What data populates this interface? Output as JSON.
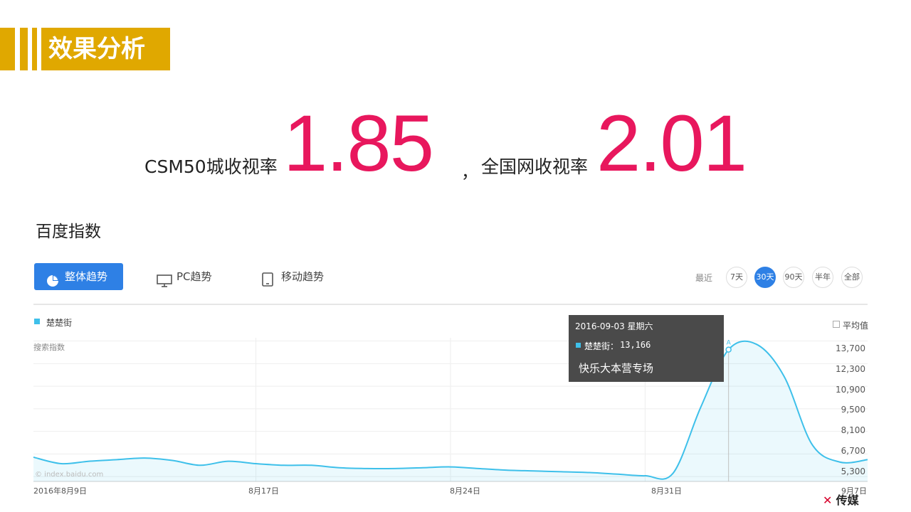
{
  "header": {
    "title": "效果分析"
  },
  "kpis": [
    {
      "label": "CSM50城收视率",
      "value": "1.85"
    },
    {
      "label": "全国网收视率",
      "value": "2.01"
    }
  ],
  "separator": "，",
  "section_title": "百度指数",
  "tabs": [
    {
      "label": "整体趋势",
      "icon": "pie-chart-icon",
      "active": true
    },
    {
      "label": "PC趋势",
      "icon": "monitor-icon",
      "active": false
    },
    {
      "label": "移动趋势",
      "icon": "tablet-icon",
      "active": false
    }
  ],
  "range": {
    "label": "最近",
    "options": [
      "7天",
      "30天",
      "90天",
      "半年",
      "全部"
    ],
    "selected": "30天"
  },
  "legend": {
    "series": "楚楚街",
    "color": "#3ec0ea"
  },
  "metric_label": "搜索指数",
  "average_toggle": "平均值",
  "watermark": "© index.baidu.com",
  "tooltip": {
    "date": "2016-09-03 星期六",
    "series": "楚楚街：",
    "value": "13,166",
    "note": "快乐大本营专场"
  },
  "brand": " 传媒",
  "colors": {
    "accent": "#e0a800",
    "kpi": "#e8175d",
    "line": "#3ec0ea",
    "tab_active": "#2e80e5"
  },
  "chart_data": {
    "type": "area",
    "series": [
      {
        "name": "楚楚街",
        "points": [
          [
            "2016-08-09",
            6500
          ],
          [
            "2016-08-10",
            6100
          ],
          [
            "2016-08-11",
            6250
          ],
          [
            "2016-08-12",
            6350
          ],
          [
            "2016-08-13",
            6450
          ],
          [
            "2016-08-14",
            6300
          ],
          [
            "2016-08-15",
            6000
          ],
          [
            "2016-08-16",
            6250
          ],
          [
            "2016-08-17",
            6100
          ],
          [
            "2016-08-18",
            6000
          ],
          [
            "2016-08-19",
            6000
          ],
          [
            "2016-08-20",
            5850
          ],
          [
            "2016-08-21",
            5800
          ],
          [
            "2016-08-22",
            5800
          ],
          [
            "2016-08-23",
            5850
          ],
          [
            "2016-08-24",
            5900
          ],
          [
            "2016-08-25",
            5800
          ],
          [
            "2016-08-26",
            5700
          ],
          [
            "2016-08-27",
            5650
          ],
          [
            "2016-08-28",
            5600
          ],
          [
            "2016-08-29",
            5550
          ],
          [
            "2016-08-30",
            5450
          ],
          [
            "2016-08-31",
            5350
          ],
          [
            "2016-09-01",
            5500
          ],
          [
            "2016-09-02",
            9600
          ],
          [
            "2016-09-03",
            13166
          ],
          [
            "2016-09-04",
            13500
          ],
          [
            "2016-09-05",
            11500
          ],
          [
            "2016-09-06",
            7300
          ],
          [
            "2016-09-07",
            6200
          ],
          [
            "2016-09-08",
            6350
          ]
        ]
      }
    ],
    "y_ticks": [
      "13,700",
      "12,300",
      "10,900",
      "9,500",
      "8,100",
      "6,700",
      "5,300"
    ],
    "x_ticks": [
      "2016年8月9日",
      "8月17日",
      "8月24日",
      "8月31日",
      "9月7日"
    ],
    "highlight": {
      "date": "2016-09-03",
      "marker": "A"
    },
    "grid": true
  }
}
